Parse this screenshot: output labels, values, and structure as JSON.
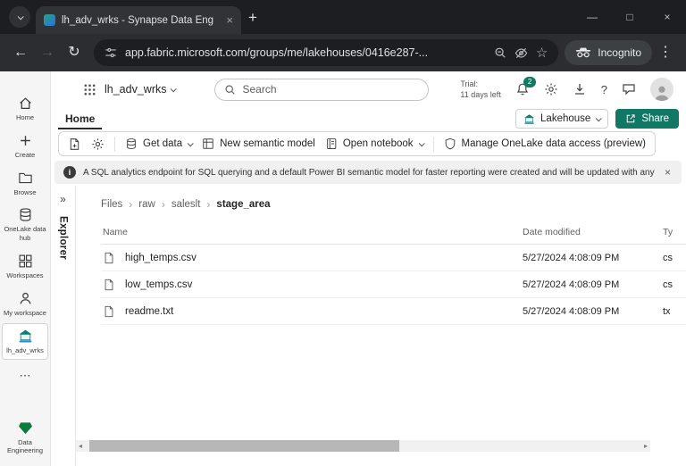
{
  "colors": {
    "accent_teal": "#117865",
    "share_button": "#117865",
    "notification_badge": "#117865",
    "browser_frame": "#1d1e21",
    "banner_bg": "#f0f0f0"
  },
  "browser": {
    "tab_title": "lh_adv_wrks - Synapse Data Eng",
    "url": "app.fabric.microsoft.com/groups/me/lakehouses/0416e287-...",
    "incognito_label": "Incognito"
  },
  "icons": {
    "back": "←",
    "forward": "→",
    "refresh": "↻",
    "star": "☆",
    "menu": "⋮",
    "minimize": "—",
    "maximize": "□",
    "close": "×",
    "new_tab": "+",
    "expand": "»",
    "crumb_separator": "›",
    "more": "⋯",
    "help": "?",
    "info": "i",
    "scroll_left": "◂",
    "scroll_right": "▸"
  },
  "header": {
    "workspace": "lh_adv_wrks",
    "search_placeholder": "Search",
    "trial_label": "Trial:",
    "trial_remaining": "11 days left",
    "notification_count": "2"
  },
  "nav": {
    "home": "Home",
    "create": "Create",
    "browse": "Browse",
    "onelake": "OneLake data hub",
    "workspaces": "Workspaces",
    "my_workspace": "My workspace",
    "lakehouse": "lh_adv_wrks",
    "data_engineering": "Data Engineering"
  },
  "ribbon": {
    "home_tab": "Home",
    "lakehouse_selector": "Lakehouse",
    "share": "Share",
    "get_data": "Get data",
    "new_semantic_model": "New semantic model",
    "open_notebook": "Open notebook",
    "manage_access": "Manage OneLake data access (preview)"
  },
  "banner": {
    "message": "A SQL analytics endpoint for SQL querying and a default Power BI semantic model for faster reporting were created and will be updated with any tables added to the lak..."
  },
  "explorer": {
    "title": "Explorer"
  },
  "files": {
    "breadcrumb": [
      "Files",
      "raw",
      "saleslt",
      "stage_area"
    ],
    "columns": {
      "name": "Name",
      "modified": "Date modified",
      "type": "Ty"
    },
    "rows": [
      {
        "name": "high_temps.csv",
        "modified": "5/27/2024 4:08:09 PM",
        "type": "cs"
      },
      {
        "name": "low_temps.csv",
        "modified": "5/27/2024 4:08:09 PM",
        "type": "cs"
      },
      {
        "name": "readme.txt",
        "modified": "5/27/2024 4:08:09 PM",
        "type": "tx"
      }
    ]
  }
}
